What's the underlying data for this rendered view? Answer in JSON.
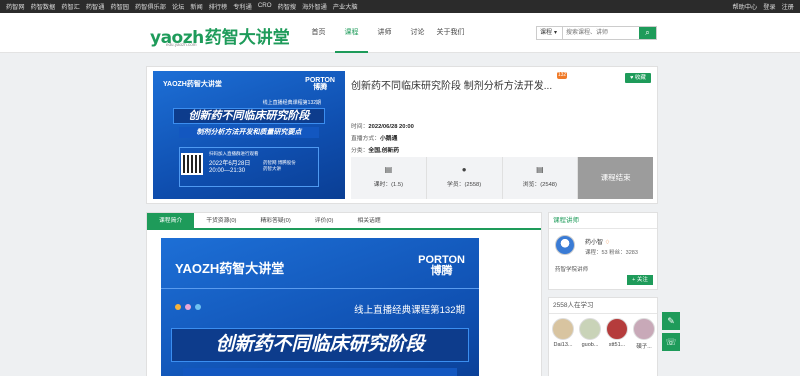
{
  "topbar": {
    "links": [
      "药智网",
      "药智数据",
      "药智汇",
      "药智通",
      "药智园",
      "药智俱乐部",
      "论坛",
      "新闻",
      "排行榜",
      "专利通",
      "CRO",
      "药智搜",
      "海外智通",
      "产业大脑"
    ],
    "right": [
      "帮助中心",
      "登录",
      "注册"
    ]
  },
  "header": {
    "logo_en": "yaozh",
    "logo_cn": "药智大讲堂",
    "logo_sub": "edu.yaozh.com",
    "nav": [
      "首页",
      "课程",
      "讲师",
      "讨论",
      "关于我们"
    ],
    "nav_active_index": 1,
    "search_select": "课程",
    "search_placeholder": "搜索课程、讲师"
  },
  "course": {
    "title": "创新药不同临床研究阶段 制剂分析方法开发...",
    "badge": "132",
    "collect_label": "收藏",
    "time_label": "时间：",
    "time_value": "2022/06/28 20:00",
    "mode_label": "直播方式：",
    "mode_value": "小鹅通",
    "category_label": "分类：",
    "category_value": "全国,创新药",
    "stats": [
      {
        "icon": "book-icon",
        "label": "课时：(1.5)"
      },
      {
        "icon": "user-icon",
        "label": "学员：(2558)"
      },
      {
        "icon": "book-icon",
        "label": "浏览：(2548)"
      }
    ],
    "status": "课程结束",
    "cover": {
      "brand": "YAOZH药智大讲堂",
      "porton_en": "PORTON",
      "porton_cn": "博腾",
      "period": "线上直播经典课程第132期",
      "title1": "创新药不同临床研究阶段",
      "title2": "制剂分析方法开发和质量研究要点",
      "qr_text": "扫码加入直播群进行观看",
      "date": "2022年6月28日",
      "time": "20:00—21:30",
      "org1": "药智网  博腾股份",
      "org2": "药智大讲"
    }
  },
  "tabs": [
    "课程简介",
    "干货资源(0)",
    "精彩答疑(0)",
    "评价(0)",
    "相关话题"
  ],
  "detail": {
    "brand": "YAOZH药智大讲堂",
    "porton_en": "PORTON",
    "porton_cn": "博腾",
    "period": "线上直播经典课程第132期",
    "big_title": "创新药不同临床研究阶段",
    "dot_colors": [
      "#f5b23a",
      "#e9a7d6",
      "#6ec1f0"
    ]
  },
  "teacher": {
    "section_title": "课程讲师",
    "name": "药小智",
    "info": "课程：53  粉丝：3283",
    "desc": "药智学院讲师",
    "follow_label": "+ 关注"
  },
  "learners": {
    "title": "2558人在学习",
    "items": [
      {
        "name": "Dai13...",
        "color": "#d8c4a0"
      },
      {
        "name": "guob...",
        "color": "#c9d3b8"
      },
      {
        "name": "stt51...",
        "color": "#b53c3c"
      },
      {
        "name": "碩子...",
        "color": "#c8a9b8"
      }
    ]
  },
  "colors": {
    "accent": "#1e9b5a",
    "topbar": "#2b2b2b",
    "cover_blue": "#1d6fd6",
    "status_gray": "#9c9c9c"
  }
}
